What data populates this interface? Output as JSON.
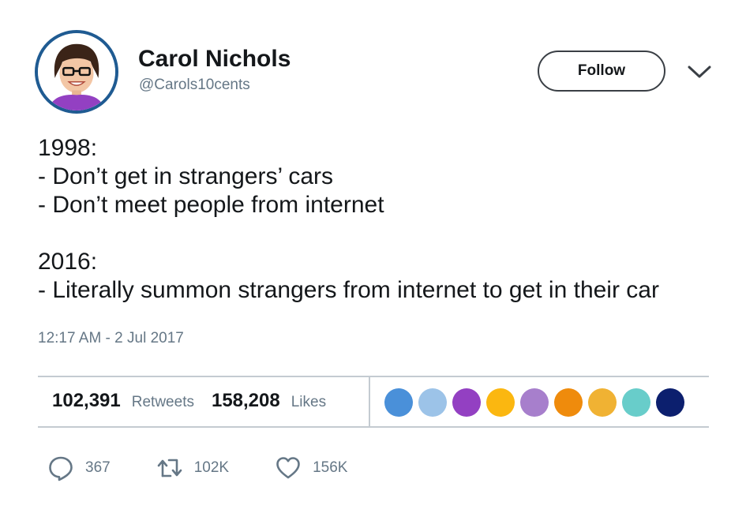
{
  "user": {
    "display_name": "Carol Nichols",
    "handle": "@Carols10cents"
  },
  "header": {
    "follow_label": "Follow",
    "menu_icon": "chevron-down-icon"
  },
  "tweet": {
    "lines_1998": [
      "1998:",
      "- Don’t get in strangers’ cars",
      "- Don’t meet people from internet"
    ],
    "lines_2016": [
      "2016:",
      "- Literally summon strangers from internet to get in their car"
    ],
    "timestamp": "12:17 AM - 2 Jul 2017"
  },
  "stats": {
    "retweets_count": "102,391",
    "retweets_label": "Retweets",
    "likes_count": "158,208",
    "likes_label": "Likes"
  },
  "likers_colors": [
    "#4a90d9",
    "#9cc3e8",
    "#9340c2",
    "#fbb710",
    "#a77fcc",
    "#ef8b0c",
    "#f0b233",
    "#68cdca",
    "#0c1f6e"
  ],
  "actions": {
    "reply_count": "367",
    "retweet_count": "102K",
    "like_count": "156K"
  },
  "colors": {
    "muted_text": "#657786",
    "avatar_border": "#1f5b92",
    "divider": "#c4cbd1"
  }
}
